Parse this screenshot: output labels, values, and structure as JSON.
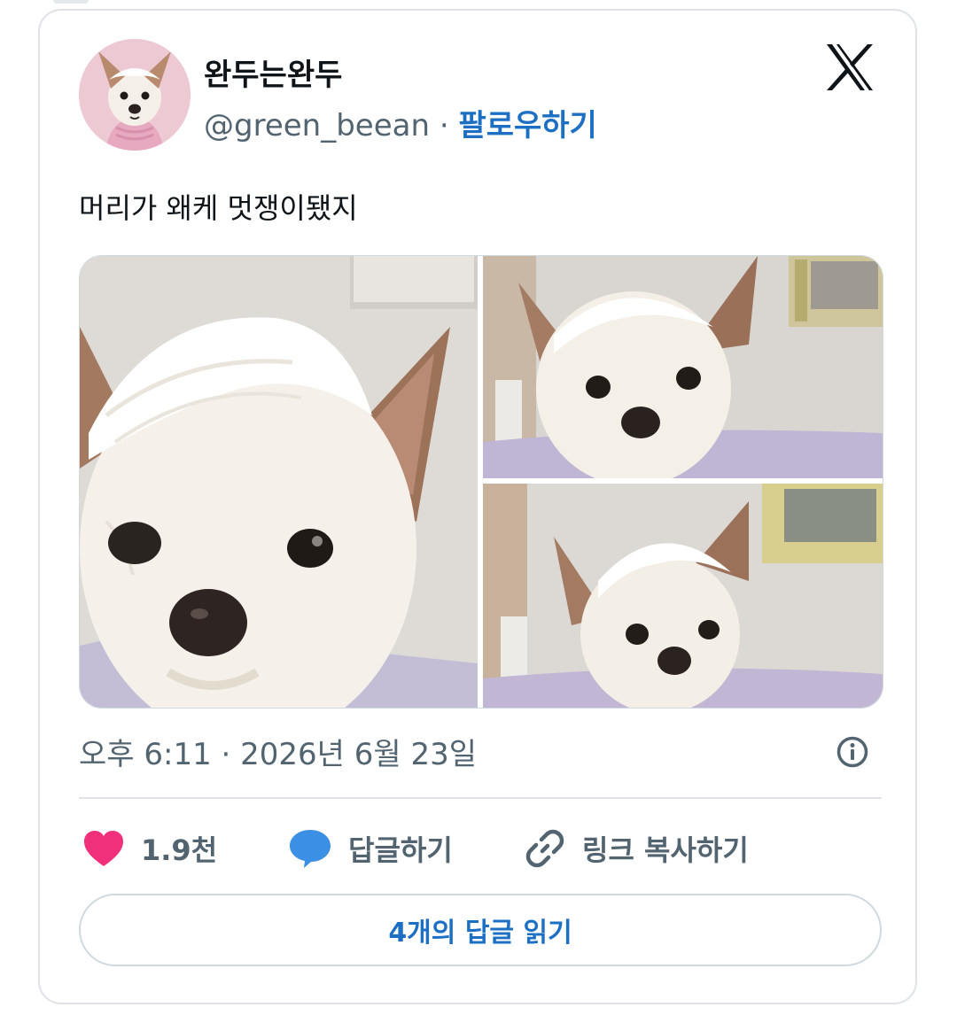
{
  "user": {
    "display_name": "완두는완두",
    "handle": "@green_beean",
    "separator": "·",
    "follow_label": "팔로우하기"
  },
  "tweet": {
    "text": "머리가 왜케 멋쟁이됐지",
    "timestamp": "오후 6:11 · 2026년 6월 23일"
  },
  "actions": {
    "like_count": "1.9천",
    "reply_label": "답글하기",
    "copy_link_label": "링크 복사하기"
  },
  "read_replies_label": "4개의 답글 읽기",
  "colors": {
    "accent": "#1d6fc4",
    "like": "#f0307a",
    "reply_icon": "#3b8fe4",
    "muted_text": "#536471",
    "border": "#dfe3e7"
  },
  "icons": {
    "logo": "x-logo-icon",
    "info": "info-icon",
    "like": "heart-icon",
    "reply": "speech-bubble-icon",
    "copy": "link-icon"
  }
}
